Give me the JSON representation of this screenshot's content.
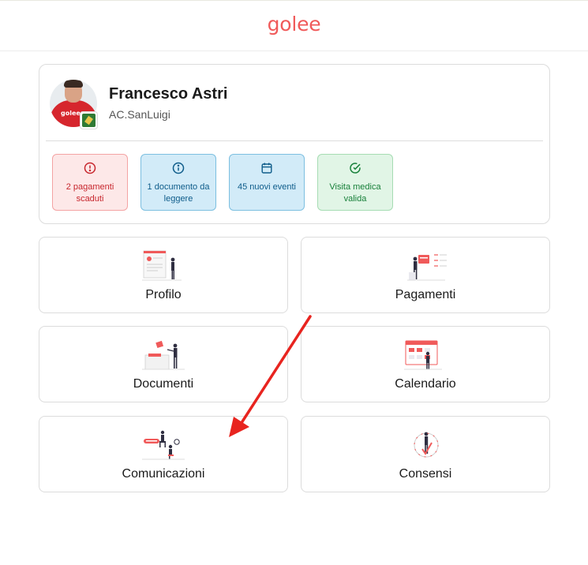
{
  "header": {
    "logo": "golee"
  },
  "profile": {
    "name": "Francesco Astri",
    "club": "AC.SanLuigi",
    "avatar_shirt_text": "golee"
  },
  "status_badges": [
    {
      "label": "2 pagamenti scaduti",
      "tone": "red",
      "icon": "alert-circle-icon",
      "color": "#c7262d"
    },
    {
      "label": "1 documento da leggere",
      "tone": "blue",
      "icon": "info-circle-icon",
      "color": "#0e5c8a"
    },
    {
      "label": "45 nuovi eventi",
      "tone": "blue",
      "icon": "calendar-icon",
      "color": "#0e5c8a"
    },
    {
      "label": "Visita medica valida",
      "tone": "green",
      "icon": "check-circle-icon",
      "color": "#18803a"
    }
  ],
  "tiles": [
    {
      "label": "Profilo",
      "icon": "profile-illustration"
    },
    {
      "label": "Pagamenti",
      "icon": "payments-illustration"
    },
    {
      "label": "Documenti",
      "icon": "documents-illustration"
    },
    {
      "label": "Calendario",
      "icon": "calendar-illustration"
    },
    {
      "label": "Comunicazioni",
      "icon": "communications-illustration"
    },
    {
      "label": "Consensi",
      "icon": "consents-illustration"
    }
  ],
  "colors": {
    "brand": "#f05a5a",
    "annotation_arrow": "#e8241f"
  }
}
